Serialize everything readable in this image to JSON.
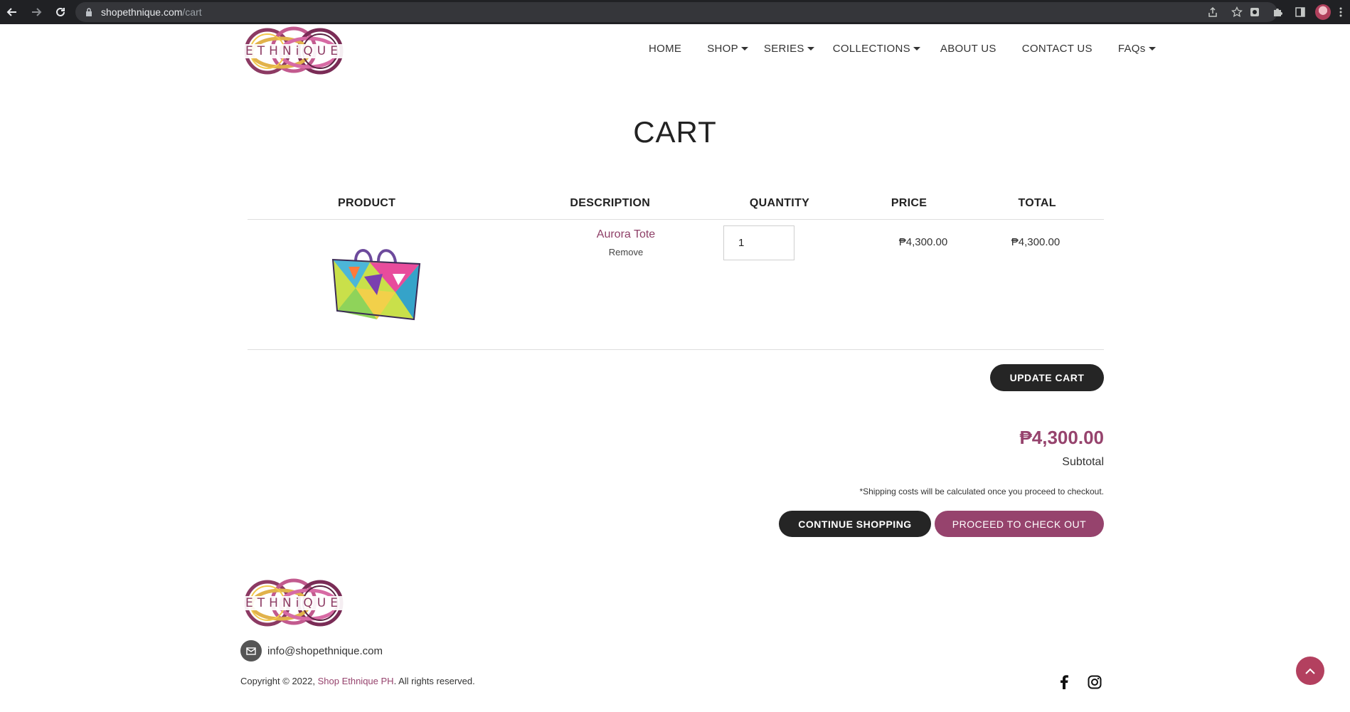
{
  "browser": {
    "url_host": "shopethnique.com",
    "url_path": "/cart"
  },
  "brand": {
    "logo_text": "ETHNiQUE",
    "accent": "#96436d",
    "dark": "#252525"
  },
  "nav": {
    "items": [
      {
        "label": "HOME",
        "dropdown": false
      },
      {
        "label": "SHOP",
        "dropdown": true
      },
      {
        "label": "SERIES",
        "dropdown": true
      },
      {
        "label": "COLLECTIONS",
        "dropdown": true
      },
      {
        "label": "ABOUT US",
        "dropdown": false
      },
      {
        "label": "CONTACT US",
        "dropdown": false
      },
      {
        "label": "FAQs",
        "dropdown": true
      }
    ]
  },
  "page": {
    "title": "CART"
  },
  "cart": {
    "columns": [
      "PRODUCT",
      "DESCRIPTION",
      "QUANTITY",
      "PRICE",
      "TOTAL"
    ],
    "items": [
      {
        "name": "Aurora Tote",
        "remove_label": "Remove",
        "quantity": "1",
        "price": "₱4,300.00",
        "total": "₱4,300.00",
        "image_icon": "tote-bag-image"
      }
    ],
    "update_label": "UPDATE CART",
    "subtotal_value": "₱4,300.00",
    "subtotal_label": "Subtotal",
    "shipping_note": "*Shipping costs will be calculated once you proceed to checkout.",
    "continue_label": "CONTINUE SHOPPING",
    "checkout_label": "PROCEED TO CHECK OUT"
  },
  "footer": {
    "email": "info@shopethnique.com",
    "copyright_prefix": "Copyright © 2022, ",
    "copyright_brand": "Shop Ethnique PH",
    "copyright_suffix": ". All rights reserved.",
    "social": [
      "facebook-icon",
      "instagram-icon"
    ]
  }
}
